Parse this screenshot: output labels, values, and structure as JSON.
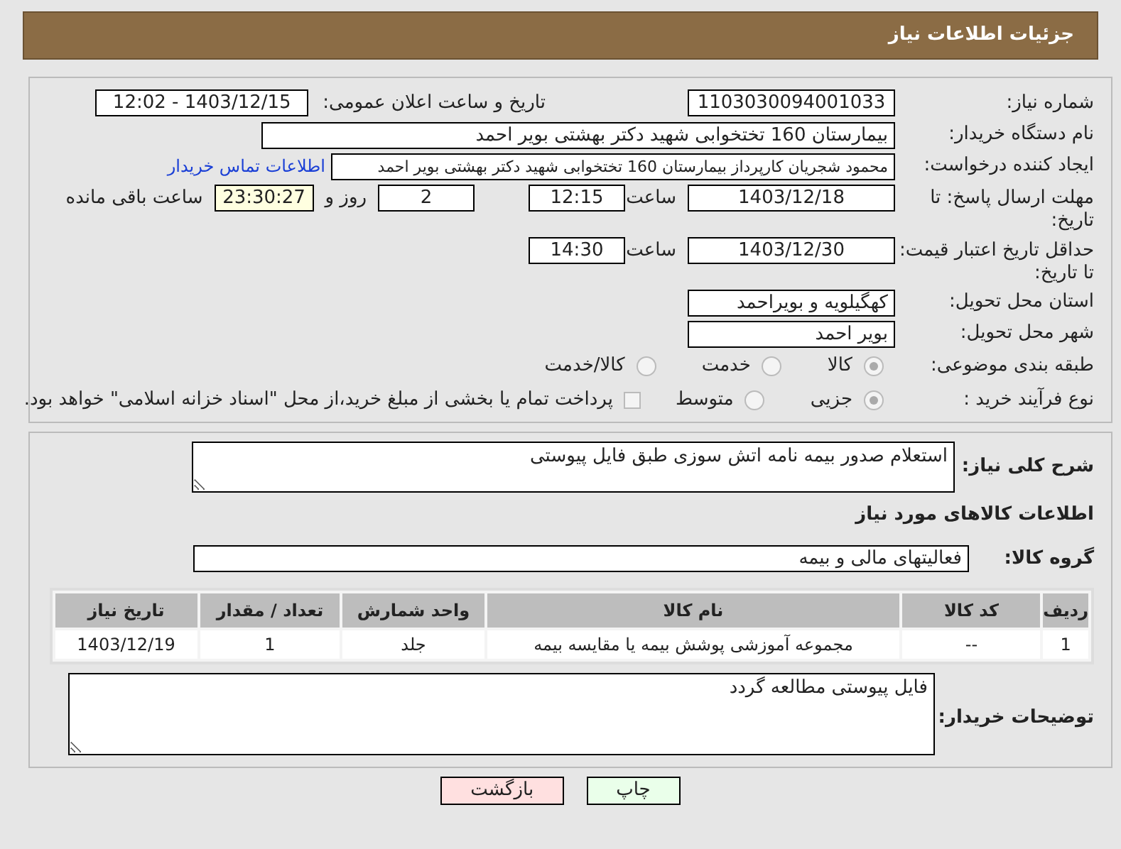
{
  "header": {
    "title": "جزئیات اطلاعات نیاز"
  },
  "need_number": {
    "label": "شماره نیاز:",
    "value": "1103030094001033"
  },
  "announce": {
    "label": "تاریخ و ساعت اعلان عمومی:",
    "value": "1403/12/15 - 12:02"
  },
  "buyer_org": {
    "label": "نام دستگاه خریدار:",
    "value": "بیمارستان 160 تختخوابی شهید دکتر بهشتی بویر احمد"
  },
  "requester": {
    "label": "ایجاد کننده درخواست:",
    "value": "محمود شجریان کارپرداز بیمارستان 160 تختخوابی شهید دکتر بهشتی بویر احمد",
    "link": "اطلاعات تماس خریدار"
  },
  "reply_deadline": {
    "label": "مهلت ارسال پاسخ: تا تاریخ:",
    "date": "1403/12/18",
    "time_label": "ساعت",
    "time": "12:15",
    "days": "2",
    "days_label": "روز و",
    "remaining": "23:30:27",
    "remaining_label": "ساعت باقی مانده"
  },
  "validity": {
    "label": "حداقل تاریخ اعتبار قیمت: تا تاریخ:",
    "date": "1403/12/30",
    "time_label": "ساعت",
    "time": "14:30"
  },
  "province": {
    "label": "استان محل تحویل:",
    "value": "کهگیلویه و بویراحمد"
  },
  "city": {
    "label": "شهر محل تحویل:",
    "value": "بویر احمد"
  },
  "category": {
    "label": "طبقه بندی موضوعی:",
    "options": [
      {
        "label": "کالا",
        "selected": true
      },
      {
        "label": "خدمت",
        "selected": false
      },
      {
        "label": "کالا/خدمت",
        "selected": false
      }
    ]
  },
  "purchase_type": {
    "label": "نوع فرآیند خرید :",
    "options": [
      {
        "label": "جزیی",
        "selected": true
      },
      {
        "label": "متوسط",
        "selected": false
      }
    ],
    "payment_note": {
      "checked": false,
      "text": "پرداخت تمام یا بخشی از مبلغ خرید،از محل \"اسناد خزانه اسلامی\" خواهد بود."
    }
  },
  "description": {
    "label": "شرح کلی نیاز:",
    "value": "استعلام صدور بیمه نامه اتش سوزی طبق فایل پیوستی"
  },
  "goods_heading": "اطلاعات کالاهای مورد نیاز",
  "goods_group": {
    "label": "گروه کالا:",
    "value": "فعالیتهای مالی و بیمه"
  },
  "table": {
    "columns": [
      "ردیف",
      "کد کالا",
      "نام کالا",
      "واحد شمارش",
      "تعداد / مقدار",
      "تاریخ نیاز"
    ],
    "rows": [
      [
        "1",
        "--",
        "مجموعه آموزشی پوشش بیمه یا مقایسه بیمه",
        "جلد",
        "1",
        "1403/12/19"
      ]
    ]
  },
  "buyer_notes": {
    "label": "توضیحات خریدار:",
    "value": "فایل پیوستی مطالعه گردد"
  },
  "buttons": [
    {
      "label": "چاپ",
      "kind": "print"
    },
    {
      "label": "بازگشت",
      "kind": "back"
    }
  ]
}
